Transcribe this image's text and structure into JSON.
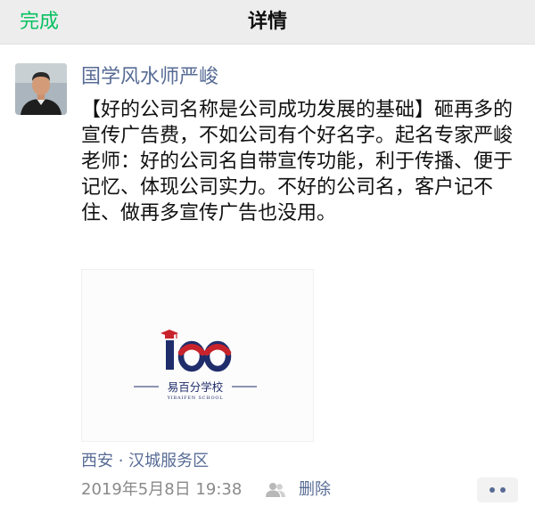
{
  "navbar": {
    "done_label": "完成",
    "title": "详情"
  },
  "post": {
    "author": "国学风水师严峻",
    "text": "【好的公司名称是公司成功发展的基础】砸再多的宣传广告费，不如公司有个好名字。起名专家严峻老师：好的公司名自带宣传功能，利于传播、便于记忆、体现公司实力。不好的公司名，客户记不住、做再多宣传广告也没用。",
    "image": {
      "logo_number": "100",
      "school_name": "易百分学校",
      "school_name_en": "YIBAIFEN SCHOOL"
    },
    "location": "西安 · 汉城服务区",
    "timestamp": "2019年5月8日 19:38",
    "delete_label": "删除"
  },
  "icons": {
    "avatar": "person-avatar",
    "visibility": "friends-icon",
    "more": "more-dots-icon",
    "graduation_cap": "graduation-cap-icon"
  },
  "colors": {
    "accent_green": "#07c160",
    "link_blue": "#576b95",
    "logo_navy": "#1f2d6b",
    "logo_red": "#c8232c"
  }
}
